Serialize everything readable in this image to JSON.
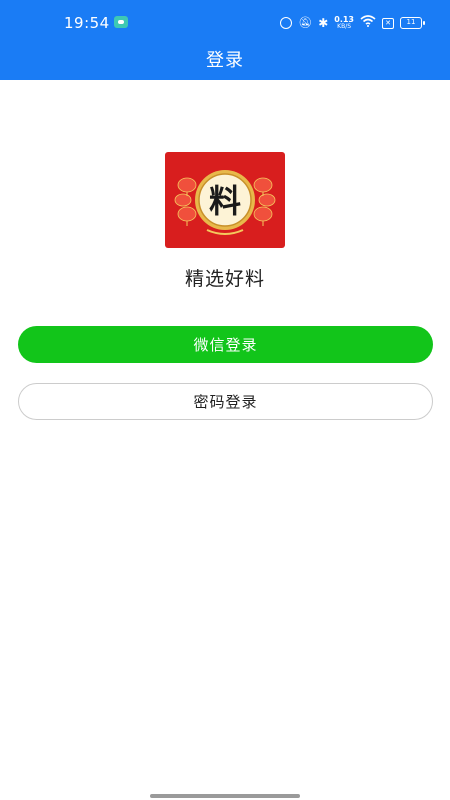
{
  "status_bar": {
    "time": "19:54",
    "net_speed_value": "0.13",
    "net_speed_unit": "KB/S",
    "battery_level": "11",
    "sim_label": "✕"
  },
  "header": {
    "title": "登录"
  },
  "logo": {
    "character": "料"
  },
  "app_name": "精选好料",
  "buttons": {
    "wechat_login": "微信登录",
    "password_login": "密码登录"
  },
  "colors": {
    "header_blue": "#1a7cf5",
    "wechat_green": "#12c51a",
    "logo_red": "#d81e1e",
    "logo_gold": "#f4c95d"
  },
  "icons": [
    "message-icon",
    "alarm-icon",
    "mute-icon",
    "bluetooth-icon",
    "wifi-icon",
    "sim-icon",
    "battery-icon"
  ]
}
